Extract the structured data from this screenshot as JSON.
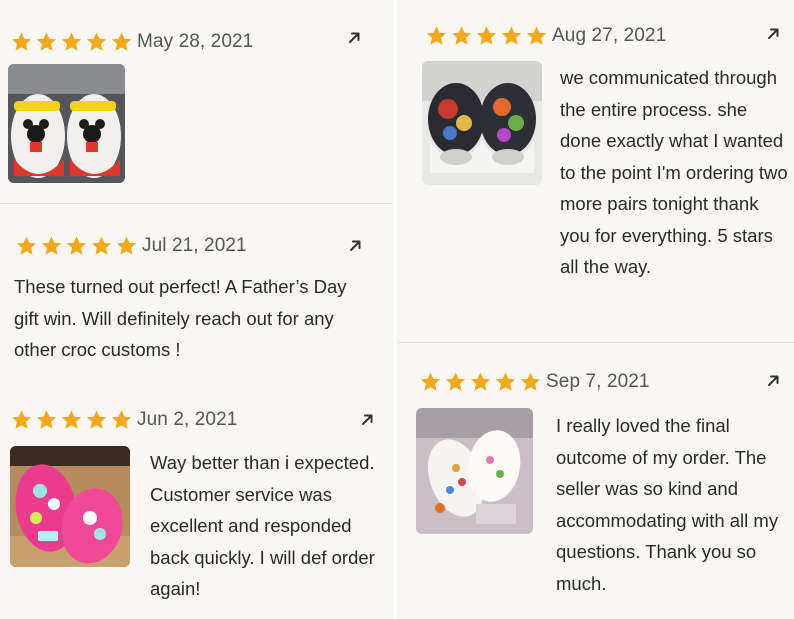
{
  "star_color": "#f1a81c",
  "reviews": [
    {
      "date": "May 28, 2021",
      "rating": 5,
      "text": "",
      "photo": "mickey-minnie-crocs"
    },
    {
      "date": "Jul 21, 2021",
      "rating": 5,
      "text": "These turned out perfect! A Father’s Day gift win. Will definitely reach out for any other croc customs !"
    },
    {
      "date": "Jun 2, 2021",
      "rating": 5,
      "text": "Way better than i expected. Customer service was excellent and responded back quickly. I will def order again!",
      "photo": "pink-crocs"
    },
    {
      "date": "Aug 27, 2021",
      "rating": 5,
      "text": "we communicated through the entire process. she done exactly what I wanted to the point I'm ordering two more pairs tonight thank you for everything. 5 stars all the way.",
      "photo": "printed-crocs"
    },
    {
      "date": "Sep 7, 2021",
      "rating": 5,
      "text": "I really loved the final outcome of my order. The seller was so kind and accommodating with all my questions. Thank you so much.",
      "photo": "white-crocs"
    }
  ],
  "icons": {
    "star": "star-icon",
    "expand": "expand-arrow-icon"
  }
}
